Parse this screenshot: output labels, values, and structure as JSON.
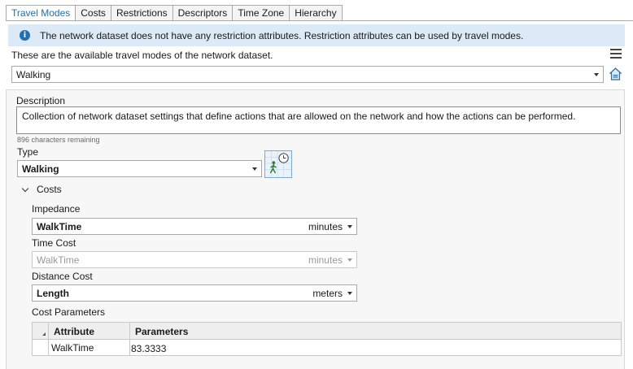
{
  "tabs": [
    {
      "label": "Travel Modes",
      "active": true
    },
    {
      "label": "Costs"
    },
    {
      "label": "Restrictions"
    },
    {
      "label": "Descriptors"
    },
    {
      "label": "Time Zone"
    },
    {
      "label": "Hierarchy"
    }
  ],
  "info": {
    "icon": "info-icon",
    "text": "The network dataset does not have any restriction attributes. Restriction attributes can be used by travel modes."
  },
  "subtitle": "These are the available travel modes of the network dataset.",
  "travel_mode_select": {
    "value": "Walking"
  },
  "description": {
    "label": "Description",
    "value": "Collection of network dataset settings that define actions that are allowed on the network and how the actions can be performed.",
    "chars_remaining": "896 characters remaining"
  },
  "type": {
    "label": "Type",
    "value": "Walking",
    "icon": "walking-time-icon"
  },
  "costs": {
    "section_label": "Costs",
    "impedance": {
      "label": "Impedance",
      "value": "WalkTime",
      "unit": "minutes"
    },
    "time_cost": {
      "label": "Time Cost",
      "value": "WalkTime",
      "unit": "minutes",
      "disabled": true
    },
    "distance_cost": {
      "label": "Distance Cost",
      "value": "Length",
      "unit": "meters"
    },
    "cost_parameters": {
      "label": "Cost Parameters",
      "columns": [
        "Attribute",
        "Parameters"
      ],
      "rows": [
        {
          "attribute": "WalkTime",
          "parameters": "83.3333"
        }
      ]
    }
  },
  "colors": {
    "accent": "#1f6fb5",
    "info_bg": "#dbeaf6",
    "panel_bg": "#f7f7f7"
  }
}
